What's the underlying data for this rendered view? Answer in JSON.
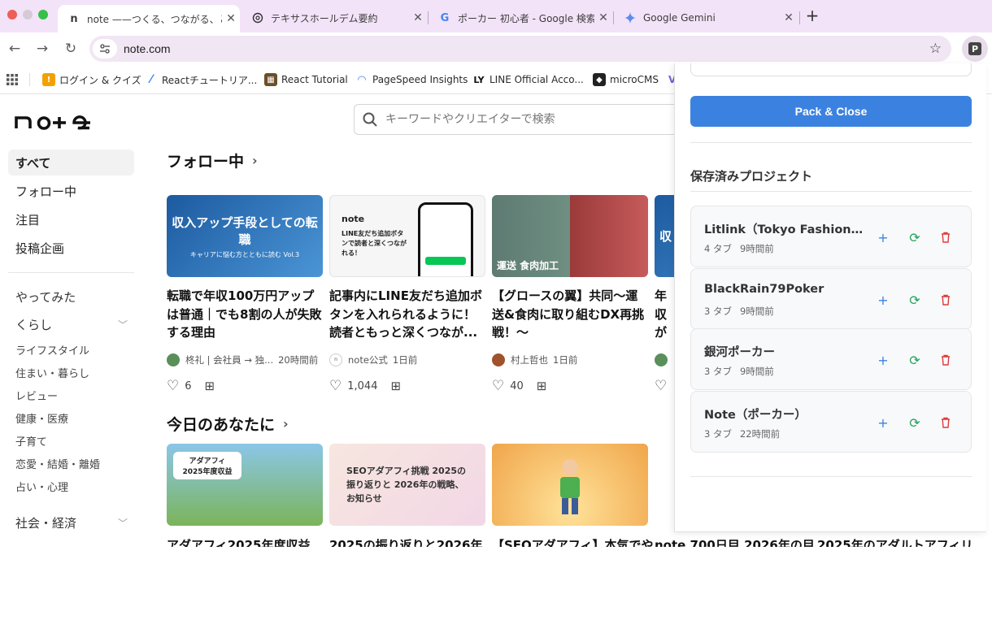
{
  "browser": {
    "tabs": [
      {
        "title": "note ——つくる、つながる、とどける。",
        "favicon": "n",
        "active": true
      },
      {
        "title": "テキサスホールデム要約",
        "favicon": "openai-icon",
        "active": false
      },
      {
        "title": "ポーカー 初心者 - Google 検索",
        "favicon": "G",
        "active": false
      },
      {
        "title": "Google Gemini",
        "favicon": "gemini-icon",
        "active": false
      }
    ],
    "url": "note.com",
    "extension_letter": "P",
    "bookmarks": [
      {
        "label": "ログイン & クイズ",
        "color": "#f2a100",
        "glyph": "!"
      },
      {
        "label": "Reactチュートリア...",
        "color": "#3b82f6",
        "glyph": "/"
      },
      {
        "label": "React Tutorial",
        "color": "#6b4f2a",
        "glyph": "▦"
      },
      {
        "label": "PageSpeed Insights",
        "color": "#4285f4",
        "glyph": "◠"
      },
      {
        "label": "LINE Official Acco...",
        "color": "#111111",
        "glyph": "LY"
      },
      {
        "label": "microCMS",
        "color": "#222222",
        "glyph": "◆"
      }
    ]
  },
  "note": {
    "logo": "note",
    "search_placeholder": "キーワードやクリエイターで検索",
    "nav_main": [
      "すべて",
      "フォロー中",
      "注目",
      "投稿企画"
    ],
    "nav_cats": [
      {
        "label": "やってみた",
        "expandable": false
      },
      {
        "label": "くらし",
        "expandable": true
      }
    ],
    "nav_subs": [
      "ライフスタイル",
      "住まい・暮らし",
      "レビュー",
      "健康・医療",
      "子育て",
      "恋愛・結婚・離婚",
      "占い・心理"
    ],
    "nav_cat2": "社会・経済",
    "section1": "フォロー中",
    "section2": "今日のあなたに",
    "cards": [
      {
        "thumb_text": "収入アップ手段としての転職",
        "thumb_sub": "キャリアに悩む方とともに読む Vol.3",
        "thumb_color": "#2b6fb6",
        "title": "転職で年収100万円アップは普通｜でも8割の人が失敗する理由",
        "author": "柊礼 | 会社員 → 独...",
        "time": "20時間前",
        "likes": "6",
        "avatar": "#5a8f5a"
      },
      {
        "thumb_text": "LINE友だち追加ボタンで読者と深くつながれる！",
        "thumb_sub": "note",
        "thumb_color": "#f4f4f4",
        "title": "記事内にLINE友だち追加ボタンを入れられるように！読者ともっと深くつなが...",
        "author": "note公式",
        "time": "1日前",
        "likes": "1,044",
        "avatar": "#222222"
      },
      {
        "thumb_text": "運送 食肉加工",
        "thumb_sub": "",
        "thumb_color": "#6c7a7d",
        "title": "【グロースの翼】共同〜運送&食肉に取り組むDX再挑戦！〜",
        "author": "村上哲也",
        "time": "1日前",
        "likes": "40",
        "avatar": "#a0522d"
      },
      {
        "thumb_text": "収",
        "thumb_sub": "",
        "thumb_color": "#2b6fb6",
        "title": "年収が最値",
        "author": "",
        "time": "",
        "likes": "",
        "avatar": "#5a8f5a"
      }
    ],
    "cards2": [
      {
        "thumb_text": "アダアフィ 2025年度収益",
        "color": "#6fa85a"
      },
      {
        "thumb_text": "SEOアダアフィ挑戦 2025の振り返りと 2026年の戦略、お知らせ",
        "color": "#f6d9d9"
      },
      {
        "thumb_text": "",
        "color": "#f4b35a"
      }
    ],
    "row3_titles": [
      "アダアフィ2025年度収益",
      "2025の振り返りと2026年",
      "【SEOアダアフィ】本気でや",
      "note 700日目 2026年の目",
      "2025年のアダルトアフィリ"
    ]
  },
  "popup": {
    "pack_button": "Pack & Close",
    "saved_title": "保存済みプロジェクト",
    "projects": [
      {
        "name": "Litlink（Tokyo Fashion Dig...",
        "tabs": "4 タブ",
        "time": "9時間前"
      },
      {
        "name": "BlackRain79Poker",
        "tabs": "3 タブ",
        "time": "9時間前"
      },
      {
        "name": "銀河ポーカー",
        "tabs": "3 タブ",
        "time": "9時間前"
      },
      {
        "name": "Note（ポーカー）",
        "tabs": "3 タブ",
        "time": "22時間前"
      }
    ],
    "colors": {
      "add": "#3b82e0",
      "restore": "#22a35a",
      "delete": "#e03b3b",
      "button": "#3b82e0"
    }
  }
}
